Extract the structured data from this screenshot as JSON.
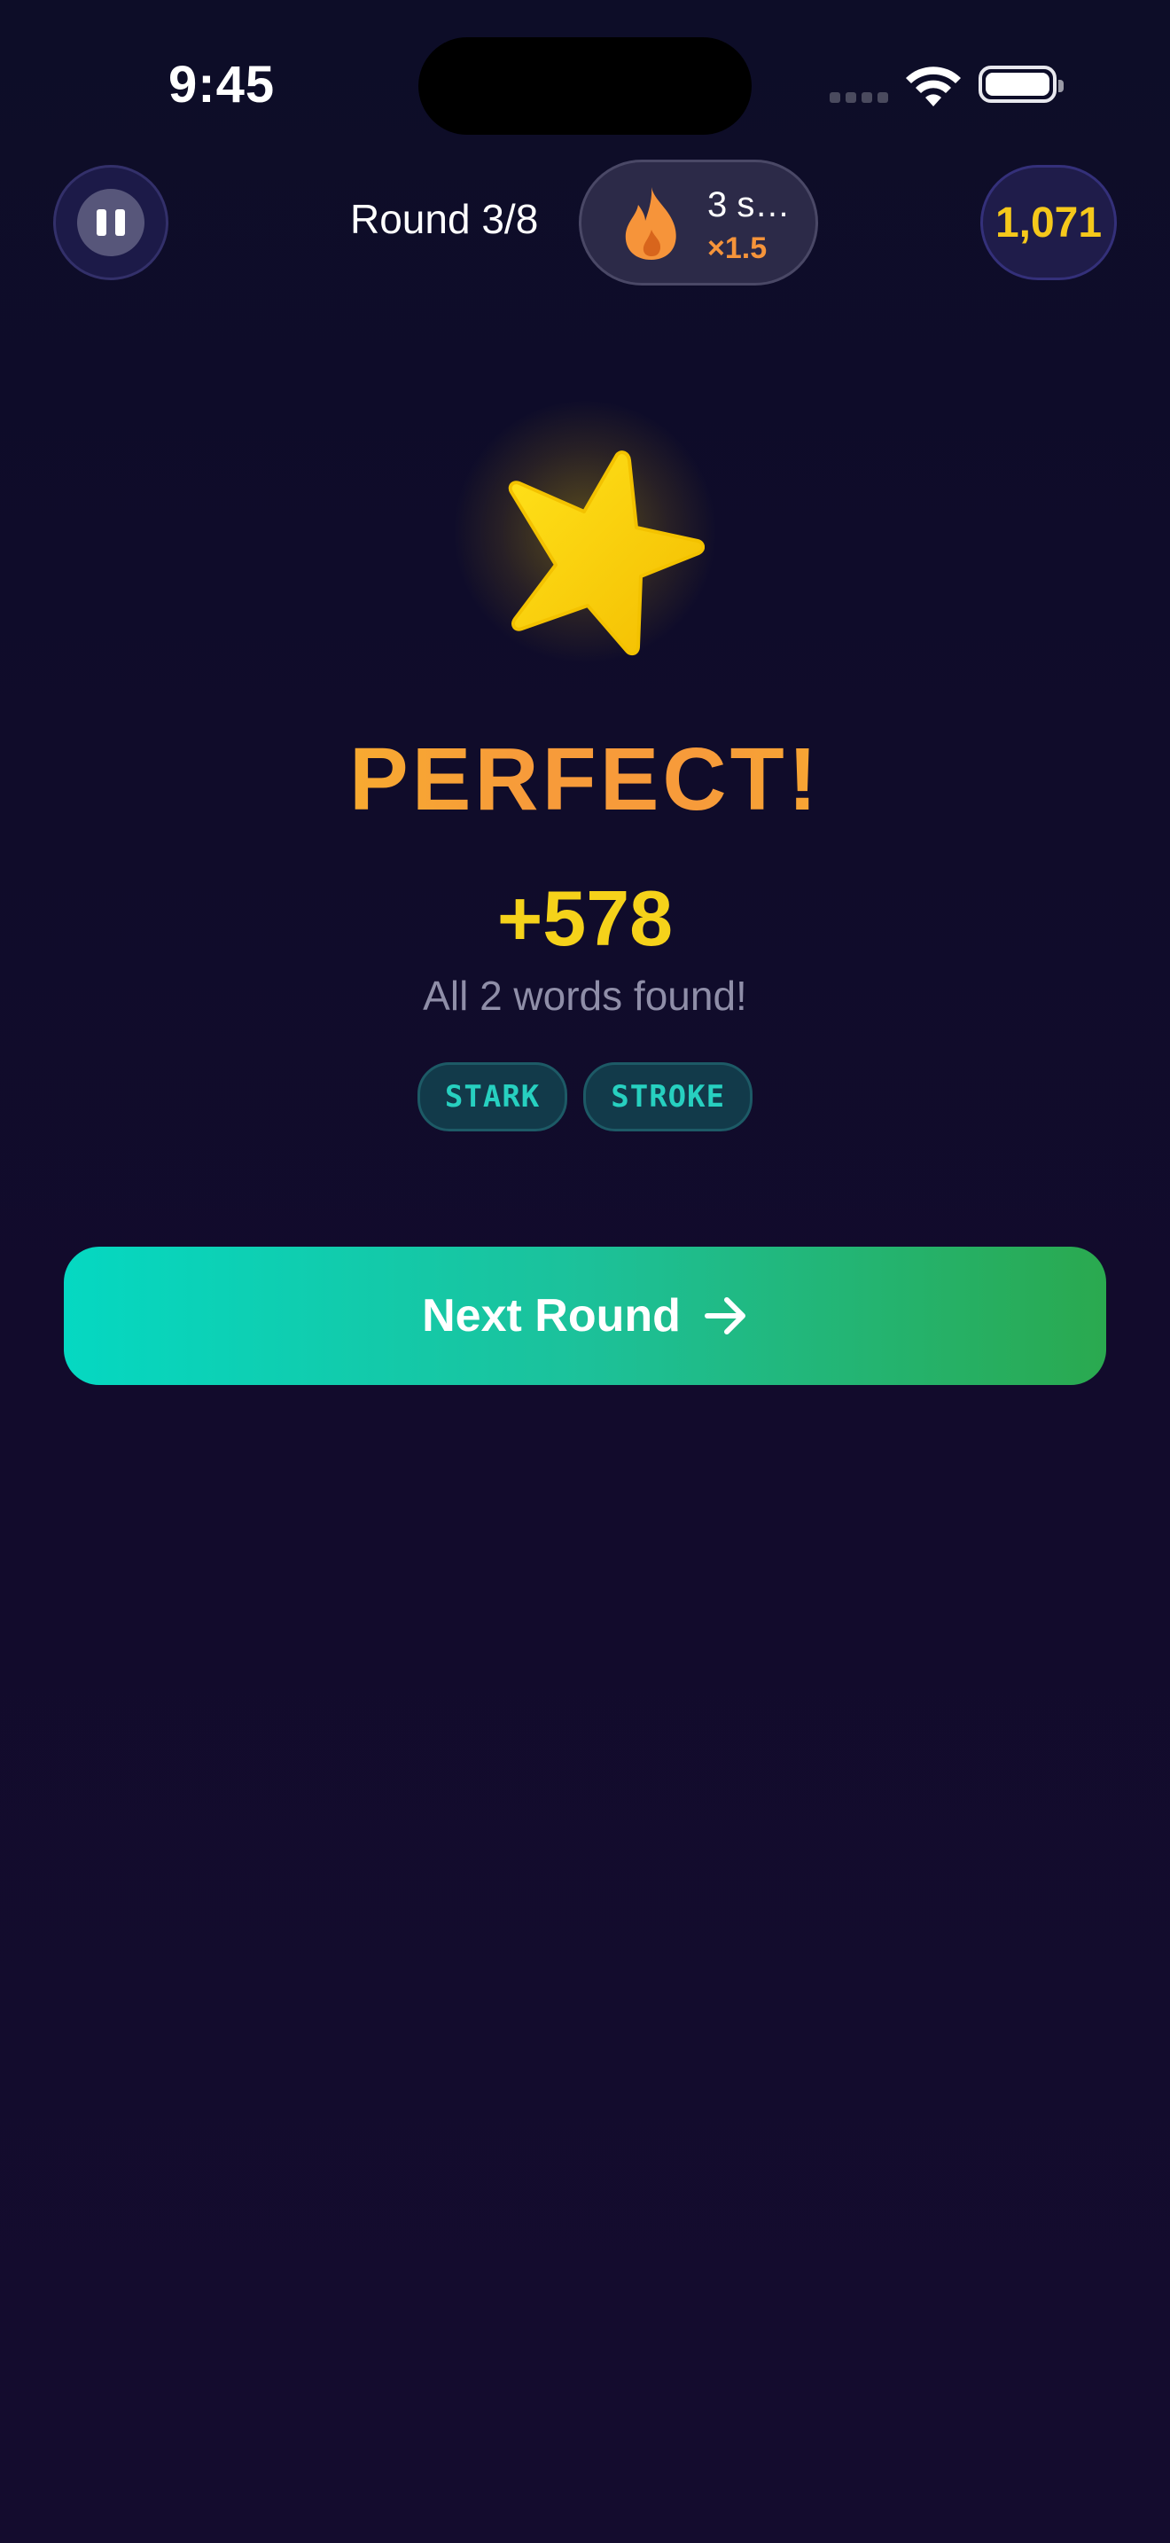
{
  "status_bar": {
    "time": "9:45"
  },
  "header": {
    "round_label": "Round 3/8",
    "streak_text": "3 s…",
    "streak_multiplier": "×1.5",
    "score": "1,071"
  },
  "result": {
    "title": "PERFECT!",
    "points": "+578",
    "subtitle": "All 2 words found!",
    "words": [
      "STARK",
      "STROKE"
    ]
  },
  "actions": {
    "next_label": "Next Round"
  },
  "colors": {
    "accent_gold": "#f5d21a",
    "accent_orange": "#f79b3a",
    "accent_teal": "#27d0c0",
    "button_start": "#05d8c2",
    "button_end": "#2aa94f"
  }
}
